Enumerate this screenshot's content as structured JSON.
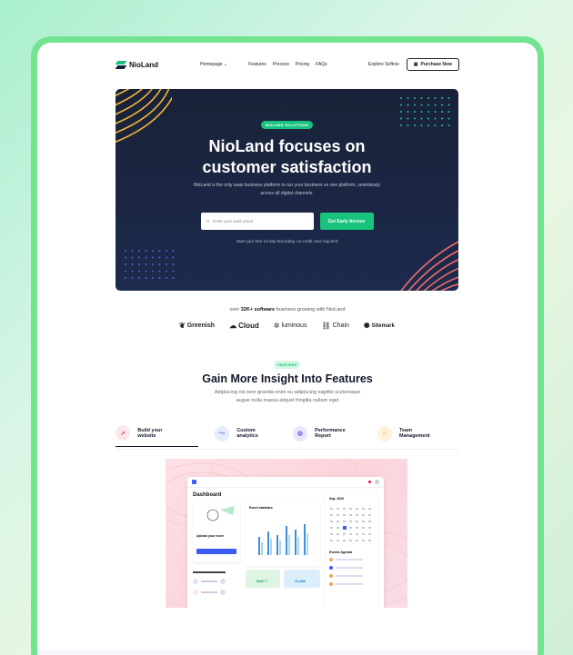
{
  "nav": {
    "brand": "NioLand",
    "menu": [
      "Homepage",
      "Features",
      "Process",
      "Pricing",
      "FAQs"
    ],
    "explore": "Explore Softnio",
    "purchase": "Purchase Now"
  },
  "hero": {
    "badge": "NIOLAND SOLUTIONS",
    "title_line1": "NioLand focuses on",
    "title_line2": "customer satisfaction",
    "description": "NioLand is the only saas business platform to run your business on one platform, seamlessly across all digital channels.",
    "email_placeholder": "Enter your work email",
    "cta": "Get Early Access",
    "trial_note": "Start your free 14-day trial today, no credit card required"
  },
  "trust": {
    "prefix": "over ",
    "count": "32K+ software",
    "suffix": " business growing with NioLand",
    "brands": [
      {
        "name": "Greenish",
        "icon": "leaf-icon"
      },
      {
        "name": "Cloud",
        "icon": "cloud-icon"
      },
      {
        "name": "luminous",
        "icon": "sun-icon"
      },
      {
        "name": "Chain",
        "icon": "chain-icon"
      },
      {
        "name": "Sitemark",
        "icon": "star-icon"
      }
    ]
  },
  "features": {
    "chip": "FEATURES",
    "title": "Gain More Insight Into Features",
    "sub_line1": "Adipiscing nis sem gravida enim eu adipiscing sagittis scelerisque",
    "sub_line2": "augue nulla massa aliquet fringilla nullam eget",
    "tabs": [
      {
        "label": "Build your website",
        "icon": "rocket-icon",
        "color": "#fde7ea",
        "icon_color": "#f0506e"
      },
      {
        "label": "Custom analytics",
        "icon": "analytics-icon",
        "color": "#e6ecfb",
        "icon_color": "#5b7de8"
      },
      {
        "label": "Performance Report",
        "icon": "report-icon",
        "color": "#ece6fb",
        "icon_color": "#8a6ee0"
      },
      {
        "label": "Team Management",
        "icon": "team-icon",
        "color": "#fff1dc",
        "icon_color": "#f0a43a"
      }
    ]
  },
  "dashboard": {
    "title": "Dashboard",
    "stats_title": "Event statistics",
    "calendar_month": "Sep, 2020",
    "agenda_title": "Events Agenda",
    "upload_title": "Upload your more",
    "stat1": "$487.7",
    "stat2": "11,886"
  },
  "colors": {
    "accent": "#19c37d",
    "hero_bg": "#192238",
    "stroke_yellow": "#f2b53a",
    "stroke_red": "#f06b6b",
    "dot_teal": "#1fc1a8",
    "dot_blue": "#4a66d8"
  }
}
